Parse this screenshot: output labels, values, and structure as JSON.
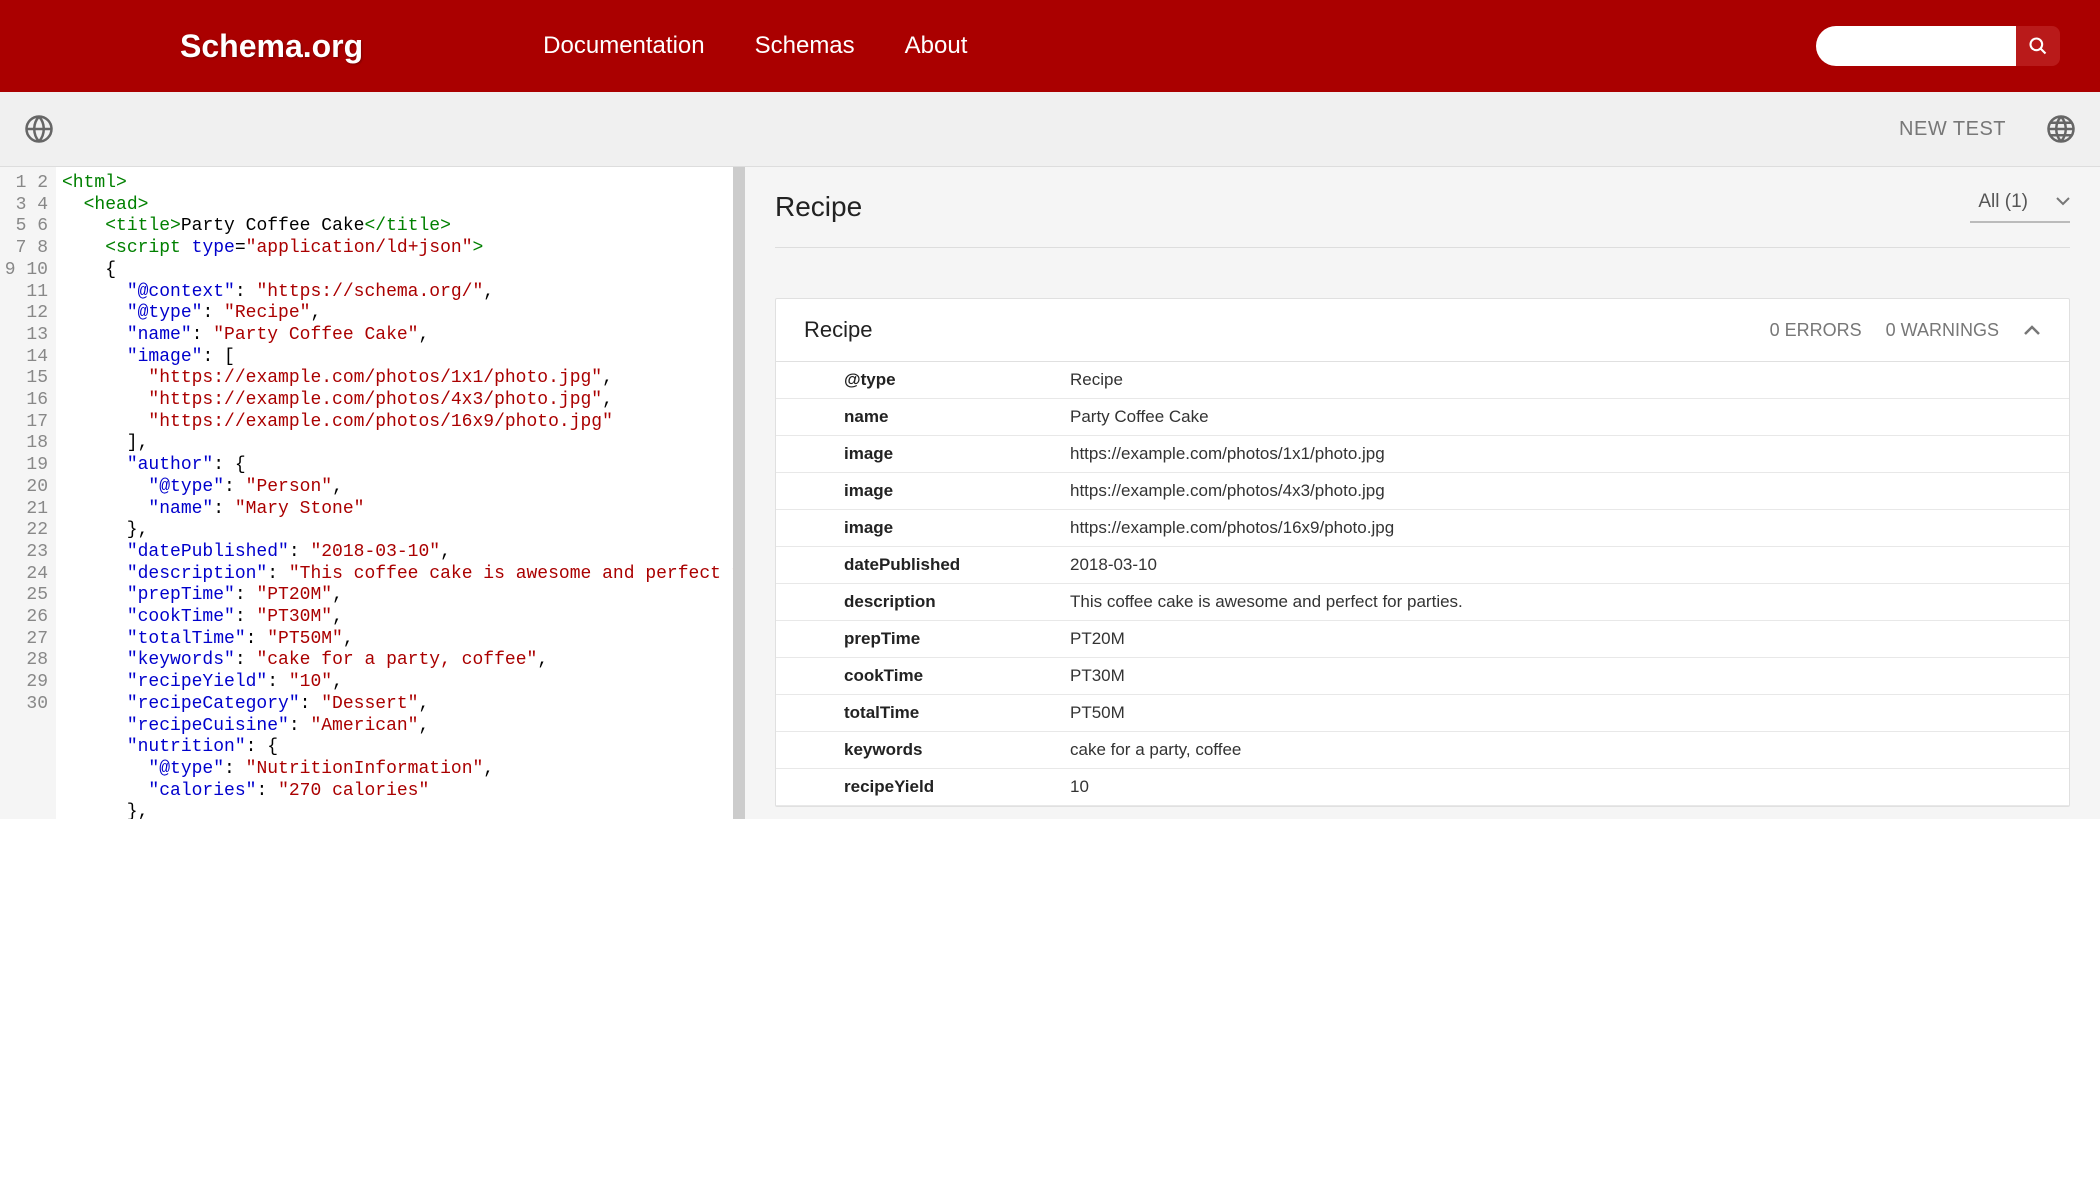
{
  "header": {
    "logo": "Schema.org",
    "nav": [
      "Documentation",
      "Schemas",
      "About"
    ]
  },
  "subbar": {
    "new_test": "NEW TEST"
  },
  "editor": {
    "line_count": 30,
    "tokens": [
      [
        [
          "<html>",
          "green"
        ]
      ],
      [
        [
          "  ",
          ""
        ],
        [
          "<head>",
          "green"
        ]
      ],
      [
        [
          "    ",
          ""
        ],
        [
          "<title>",
          "green"
        ],
        [
          "Party Coffee Cake",
          "black"
        ],
        [
          "</title>",
          "green"
        ]
      ],
      [
        [
          "    ",
          ""
        ],
        [
          "<script ",
          "green"
        ],
        [
          "type",
          "blue"
        ],
        [
          "=",
          "black"
        ],
        [
          "\"application/ld+json\"",
          "red"
        ],
        [
          ">",
          "green"
        ]
      ],
      [
        [
          "    {",
          "black"
        ]
      ],
      [
        [
          "      ",
          ""
        ],
        [
          "\"@context\"",
          "blue"
        ],
        [
          ": ",
          "black"
        ],
        [
          "\"https://schema.org/\"",
          "red"
        ],
        [
          ",",
          "black"
        ]
      ],
      [
        [
          "      ",
          ""
        ],
        [
          "\"@type\"",
          "blue"
        ],
        [
          ": ",
          "black"
        ],
        [
          "\"Recipe\"",
          "red"
        ],
        [
          ",",
          "black"
        ]
      ],
      [
        [
          "      ",
          ""
        ],
        [
          "\"name\"",
          "blue"
        ],
        [
          ": ",
          "black"
        ],
        [
          "\"Party Coffee Cake\"",
          "red"
        ],
        [
          ",",
          "black"
        ]
      ],
      [
        [
          "      ",
          ""
        ],
        [
          "\"image\"",
          "blue"
        ],
        [
          ": [",
          "black"
        ]
      ],
      [
        [
          "        ",
          ""
        ],
        [
          "\"https://example.com/photos/1x1/photo.jpg\"",
          "red"
        ],
        [
          ",",
          "black"
        ]
      ],
      [
        [
          "        ",
          ""
        ],
        [
          "\"https://example.com/photos/4x3/photo.jpg\"",
          "red"
        ],
        [
          ",",
          "black"
        ]
      ],
      [
        [
          "        ",
          ""
        ],
        [
          "\"https://example.com/photos/16x9/photo.jpg\"",
          "red"
        ]
      ],
      [
        [
          "      ],",
          "black"
        ]
      ],
      [
        [
          "      ",
          ""
        ],
        [
          "\"author\"",
          "blue"
        ],
        [
          ": {",
          "black"
        ]
      ],
      [
        [
          "        ",
          ""
        ],
        [
          "\"@type\"",
          "blue"
        ],
        [
          ": ",
          "black"
        ],
        [
          "\"Person\"",
          "red"
        ],
        [
          ",",
          "black"
        ]
      ],
      [
        [
          "        ",
          ""
        ],
        [
          "\"name\"",
          "blue"
        ],
        [
          ": ",
          "black"
        ],
        [
          "\"Mary Stone\"",
          "red"
        ]
      ],
      [
        [
          "      },",
          "black"
        ]
      ],
      [
        [
          "      ",
          ""
        ],
        [
          "\"datePublished\"",
          "blue"
        ],
        [
          ": ",
          "black"
        ],
        [
          "\"2018-03-10\"",
          "red"
        ],
        [
          ",",
          "black"
        ]
      ],
      [
        [
          "      ",
          ""
        ],
        [
          "\"description\"",
          "blue"
        ],
        [
          ": ",
          "black"
        ],
        [
          "\"This coffee cake is awesome and perfect for partie",
          "red"
        ]
      ],
      [
        [
          "      ",
          ""
        ],
        [
          "\"prepTime\"",
          "blue"
        ],
        [
          ": ",
          "black"
        ],
        [
          "\"PT20M\"",
          "red"
        ],
        [
          ",",
          "black"
        ]
      ],
      [
        [
          "      ",
          ""
        ],
        [
          "\"cookTime\"",
          "blue"
        ],
        [
          ": ",
          "black"
        ],
        [
          "\"PT30M\"",
          "red"
        ],
        [
          ",",
          "black"
        ]
      ],
      [
        [
          "      ",
          ""
        ],
        [
          "\"totalTime\"",
          "blue"
        ],
        [
          ": ",
          "black"
        ],
        [
          "\"PT50M\"",
          "red"
        ],
        [
          ",",
          "black"
        ]
      ],
      [
        [
          "      ",
          ""
        ],
        [
          "\"keywords\"",
          "blue"
        ],
        [
          ": ",
          "black"
        ],
        [
          "\"cake for a party, coffee\"",
          "red"
        ],
        [
          ",",
          "black"
        ]
      ],
      [
        [
          "      ",
          ""
        ],
        [
          "\"recipeYield\"",
          "blue"
        ],
        [
          ": ",
          "black"
        ],
        [
          "\"10\"",
          "red"
        ],
        [
          ",",
          "black"
        ]
      ],
      [
        [
          "      ",
          ""
        ],
        [
          "\"recipeCategory\"",
          "blue"
        ],
        [
          ": ",
          "black"
        ],
        [
          "\"Dessert\"",
          "red"
        ],
        [
          ",",
          "black"
        ]
      ],
      [
        [
          "      ",
          ""
        ],
        [
          "\"recipeCuisine\"",
          "blue"
        ],
        [
          ": ",
          "black"
        ],
        [
          "\"American\"",
          "red"
        ],
        [
          ",",
          "black"
        ]
      ],
      [
        [
          "      ",
          ""
        ],
        [
          "\"nutrition\"",
          "blue"
        ],
        [
          ": {",
          "black"
        ]
      ],
      [
        [
          "        ",
          ""
        ],
        [
          "\"@type\"",
          "blue"
        ],
        [
          ": ",
          "black"
        ],
        [
          "\"NutritionInformation\"",
          "red"
        ],
        [
          ",",
          "black"
        ]
      ],
      [
        [
          "        ",
          ""
        ],
        [
          "\"calories\"",
          "blue"
        ],
        [
          ": ",
          "black"
        ],
        [
          "\"270 calories\"",
          "red"
        ]
      ],
      [
        [
          "      },",
          "black"
        ]
      ]
    ]
  },
  "results": {
    "title": "Recipe",
    "filter": "All (1)",
    "card": {
      "title": "Recipe",
      "errors": "0 ERRORS",
      "warnings": "0 WARNINGS",
      "rows": [
        {
          "k": "@type",
          "v": "Recipe"
        },
        {
          "k": "name",
          "v": "Party Coffee Cake"
        },
        {
          "k": "image",
          "v": "https://example.com/photos/1x1/photo.jpg"
        },
        {
          "k": "image",
          "v": "https://example.com/photos/4x3/photo.jpg"
        },
        {
          "k": "image",
          "v": "https://example.com/photos/16x9/photo.jpg"
        },
        {
          "k": "datePublished",
          "v": "2018-03-10"
        },
        {
          "k": "description",
          "v": "This coffee cake is awesome and perfect for parties."
        },
        {
          "k": "prepTime",
          "v": "PT20M"
        },
        {
          "k": "cookTime",
          "v": "PT30M"
        },
        {
          "k": "totalTime",
          "v": "PT50M"
        },
        {
          "k": "keywords",
          "v": "cake for a party, coffee"
        },
        {
          "k": "recipeYield",
          "v": "10"
        }
      ]
    }
  }
}
